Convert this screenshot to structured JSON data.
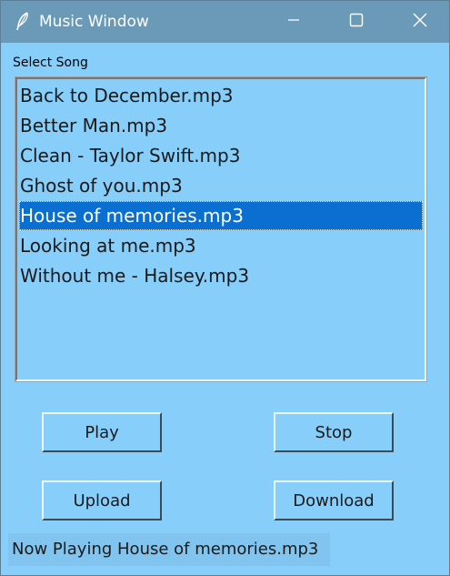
{
  "window": {
    "title": "Music Window",
    "icon": "feather-icon",
    "controls": [
      "minimize-icon",
      "maximize-icon",
      "close-icon"
    ]
  },
  "select_label": "Select Song",
  "songs": [
    {
      "label": "Back to December.mp3",
      "selected": false
    },
    {
      "label": "Better Man.mp3",
      "selected": false
    },
    {
      "label": "Clean - Taylor Swift.mp3",
      "selected": false
    },
    {
      "label": "Ghost of you.mp3",
      "selected": false
    },
    {
      "label": "House of memories.mp3",
      "selected": true
    },
    {
      "label": "Looking at me.mp3",
      "selected": false
    },
    {
      "label": "Without me - Halsey.mp3",
      "selected": false
    }
  ],
  "buttons": {
    "play": "Play",
    "stop": "Stop",
    "upload": "Upload",
    "download": "Download"
  },
  "status_text": "Now Playing House of memories.mp3",
  "colors": {
    "background": "#87cefa",
    "titlebar": "#6a9ab8",
    "selection": "#0b6fd1"
  }
}
